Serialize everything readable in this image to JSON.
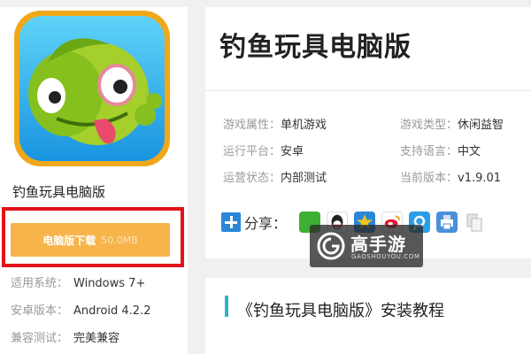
{
  "app": {
    "name": "钓鱼玩具电脑版",
    "title": "钓鱼玩具电脑版"
  },
  "download": {
    "label": "电脑版下载",
    "size": "50.0MB"
  },
  "meta": [
    {
      "key": "适用系统：",
      "value": "Windows 7+"
    },
    {
      "key": "安卓版本：",
      "value": "Android 4.2.2"
    },
    {
      "key": "兼容测试：",
      "value": "完美兼容"
    }
  ],
  "attributes": [
    {
      "key": "游戏属性：",
      "value": "单机游戏"
    },
    {
      "key": "游戏类型：",
      "value": "休闲益智"
    },
    {
      "key": "运行平台：",
      "value": "安卓"
    },
    {
      "key": "支持语言：",
      "value": "中文"
    },
    {
      "key": "运营状态：",
      "value": "内部测试"
    },
    {
      "key": "当前版本：",
      "value": "v1.9.01"
    }
  ],
  "share": {
    "label": "分享：",
    "icons": [
      "wechat-icon",
      "qq-icon",
      "qzone-icon",
      "weibo-icon",
      "tencent-weibo-icon",
      "print-icon",
      "copy-icon"
    ]
  },
  "watermark": {
    "brand": "高手游",
    "domain": "GAOSHOUYOU.COM"
  },
  "section": {
    "title": "《钓鱼玩具电脑版》安装教程"
  },
  "colors": {
    "accent_orange": "#f7b44a",
    "highlight_red": "#e3131b",
    "section_bar": "#28b6c8",
    "share_blue": "#2a86d8"
  }
}
